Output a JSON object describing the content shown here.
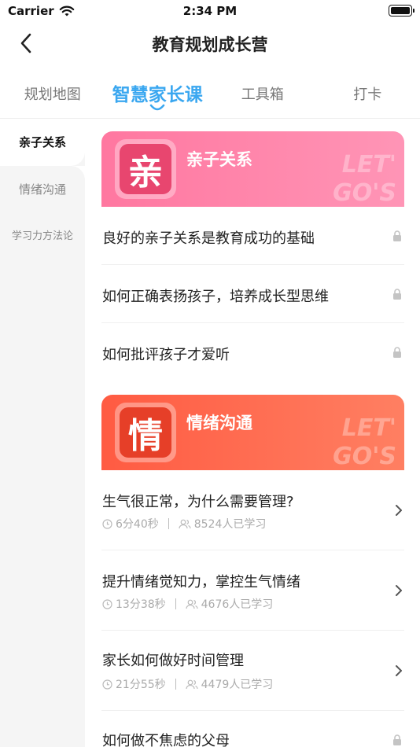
{
  "status_bar": {
    "carrier": "Carrier",
    "time": "2:34 PM"
  },
  "nav": {
    "title": "教育规划成长营"
  },
  "tabs": [
    {
      "label": "规划地图",
      "active": false
    },
    {
      "label": "智慧家长课",
      "active": true
    },
    {
      "label": "工具箱",
      "active": false
    },
    {
      "label": "打卡",
      "active": false
    }
  ],
  "sidebar": {
    "items": [
      {
        "label": "亲子关系",
        "active": true
      },
      {
        "label": "情绪沟通",
        "active": false
      },
      {
        "label": "学习力方法论",
        "active": false
      }
    ]
  },
  "sections": [
    {
      "icon_char": "亲",
      "title": "亲子关系",
      "decoration": [
        "LET'",
        "GO'S"
      ],
      "lessons": [
        {
          "title": "良好的亲子关系是教育成功的基础",
          "locked": true
        },
        {
          "title": "如何正确表扬孩子，培养成长型思维",
          "locked": true
        },
        {
          "title": "如何批评孩子才爱听",
          "locked": true
        }
      ]
    },
    {
      "icon_char": "情",
      "title": "情绪沟通",
      "decoration": [
        "LET'",
        "GO'S"
      ],
      "lessons": [
        {
          "title": "生气很正常，为什么需要管理?",
          "duration": "6分40秒",
          "learners": "8524人已学习"
        },
        {
          "title": "提升情绪觉知力，掌控生气情绪",
          "duration": "13分38秒",
          "learners": "4676人已学习"
        },
        {
          "title": "家长如何做好时间管理",
          "duration": "21分55秒",
          "learners": "4479人已学习"
        },
        {
          "title": "如何做不焦虑的父母",
          "locked": true
        }
      ]
    }
  ],
  "colors": {
    "accent": "#3aa7f0",
    "section_pink": "#ff84a8",
    "section_orange": "#ff6a50"
  }
}
